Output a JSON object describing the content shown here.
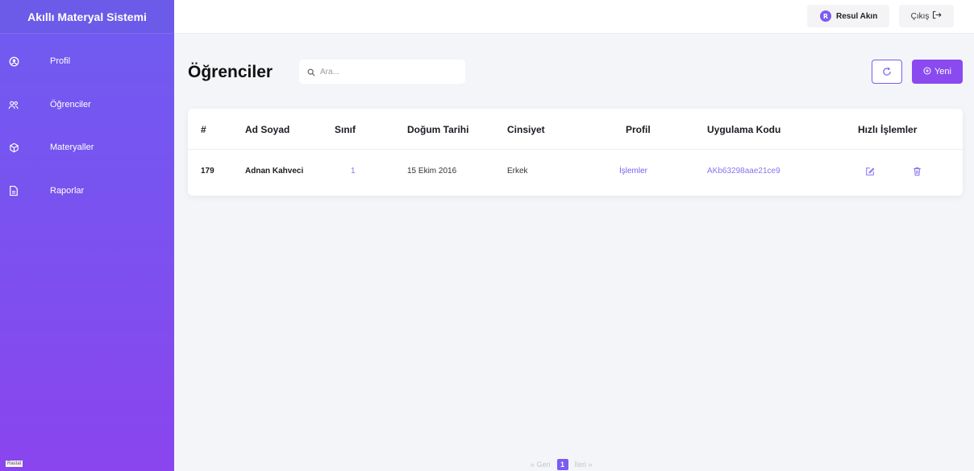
{
  "app": {
    "title": "Akıllı Materyal Sistemi"
  },
  "sidebar": {
    "items": [
      {
        "label": "Profil",
        "icon": "user-circle-icon"
      },
      {
        "label": "Öğrenciler",
        "icon": "users-icon"
      },
      {
        "label": "Materyaller",
        "icon": "cube-icon"
      },
      {
        "label": "Raporlar",
        "icon": "document-icon"
      }
    ],
    "footer_badge": "Rastat"
  },
  "topbar": {
    "user_initial": "R",
    "user_name": "Resul Akın",
    "logout_label": "Çıkış"
  },
  "page": {
    "title": "Öğrenciler",
    "search_placeholder": "Ara...",
    "new_label": "Yeni"
  },
  "table": {
    "headers": [
      "#",
      "Ad Soyad",
      "Sınıf",
      "Doğum Tarihi",
      "Cinsiyet",
      "Profil",
      "Uygulama Kodu",
      "Hızlı İşlemler"
    ],
    "rows": [
      {
        "id": "179",
        "name": "Adnan Kahveci",
        "class": "1",
        "birth_date": "15 Ekim 2016",
        "gender": "Erkek",
        "profile_link": "İşlemler",
        "app_code": "AKb63298aae21ce9"
      }
    ]
  },
  "pagination": {
    "prev": "« Geri",
    "current": "1",
    "next": "İleri »"
  },
  "colors": {
    "accent": "#7b5cf0",
    "sidebar_top": "#6f5cf1",
    "sidebar_bottom": "#8a45ee",
    "new_button": "#8a4af0"
  }
}
